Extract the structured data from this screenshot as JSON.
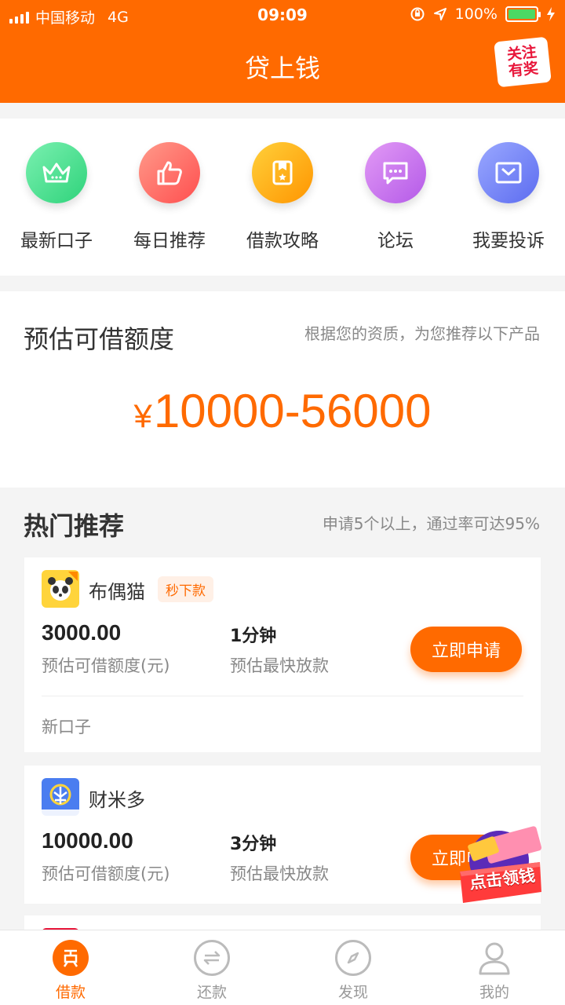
{
  "status": {
    "carrier": "中国移动",
    "network": "4G",
    "time": "09:09",
    "battery": "100%"
  },
  "header": {
    "title": "贷上钱",
    "promo": {
      "line1": "关注",
      "line2": "有奖"
    }
  },
  "quick_links": [
    {
      "label": "最新口子",
      "icon": "crown-icon",
      "color": "#3ddc84"
    },
    {
      "label": "每日推荐",
      "icon": "thumbs-up-icon",
      "color": "#ff5e5e"
    },
    {
      "label": "借款攻略",
      "icon": "bookmark-card-icon",
      "color": "#ffa41b"
    },
    {
      "label": "论坛",
      "icon": "chat-bubble-icon",
      "color": "#c06cf0"
    },
    {
      "label": "我要投诉",
      "icon": "complaint-mail-icon",
      "color": "#6f7ef5"
    }
  ],
  "estimate": {
    "title": "预估可借额度",
    "hint": "根据您的资质，为您推荐以下产品",
    "currency": "¥",
    "amount": "10000-56000"
  },
  "hot": {
    "title": "热门推荐",
    "hint": "申请5个以上，通过率可达95%",
    "cards": [
      {
        "name": "布偶猫",
        "tag": "秒下款",
        "amount": "3000.00",
        "amount_label": "预估可借额度(元)",
        "speed": "1分钟",
        "speed_label": "预估最快放款",
        "apply": "立即申请",
        "footer": "新口子"
      },
      {
        "name": "财米多",
        "amount": "10000.00",
        "amount_label": "预估可借额度(元)",
        "speed": "3分钟",
        "speed_label": "预估最快放款",
        "apply": "立即申请"
      }
    ]
  },
  "float_gift": {
    "label": "点击领钱"
  },
  "tabs": [
    {
      "label": "借款",
      "icon": "loan-icon",
      "active": true
    },
    {
      "label": "还款",
      "icon": "repay-icon",
      "active": false
    },
    {
      "label": "发现",
      "icon": "compass-icon",
      "active": false
    },
    {
      "label": "我的",
      "icon": "user-icon",
      "active": false
    }
  ],
  "colors": {
    "brand": "#ff6a00",
    "background": "#f4f4f4"
  }
}
